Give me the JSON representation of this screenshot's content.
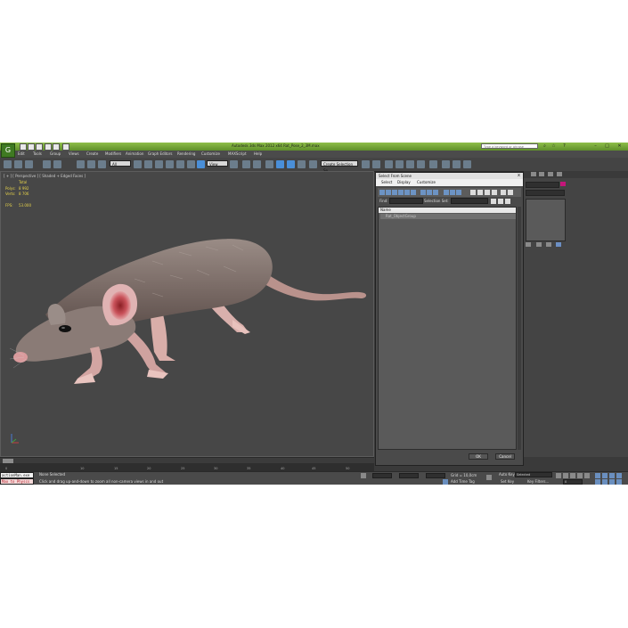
{
  "app": {
    "logo": "G",
    "title": "Autodesk 3ds Max  2012 x64     Rat_Pose_2_3M.max",
    "search_placeholder": "Type a keyword or phrase",
    "window_controls": [
      "–",
      "□",
      "✕"
    ]
  },
  "menubar": [
    "Edit",
    "Tools",
    "Group",
    "Views",
    "Create",
    "Modifiers",
    "Animation",
    "Graph Editors",
    "Rendering",
    "Customize",
    "MAXScript",
    "Help"
  ],
  "toolbar": {
    "filter_dropdown": "All",
    "refcoord_dropdown": "View",
    "named_selection": "Create Selection Se"
  },
  "viewport": {
    "label": "[ + ] [ Perspective ] [ Shaded + Edged Faces ]",
    "stats": {
      "total_label": "Total",
      "polys_label": "Polys:",
      "polys_value": "8 992",
      "verts_label": "Verts:",
      "verts_value": "8 706",
      "fps_label": "FPS:",
      "fps_value": "53.000"
    }
  },
  "dialog": {
    "title": "Select From Scene",
    "close": "x",
    "menu": [
      "Select",
      "Display",
      "Customize"
    ],
    "find_label": "Find:",
    "selection_set_label": "Selection Set:",
    "column_header": "Name",
    "rows": [
      "Rat_ObjectGroup"
    ],
    "ok_label": "OK",
    "cancel_label": "Cancel"
  },
  "timeline": {
    "ticks": [
      "0",
      "10",
      "15",
      "20",
      "25",
      "30",
      "35",
      "40",
      "45",
      "50"
    ],
    "slider_label": "0 / 100"
  },
  "status": {
    "script_line1": "actionMan.exe",
    "script_line2": "Max to Physcs",
    "selection": "None Selected",
    "prompt": "Click and drag up-and-down to zoom all non-camera views in and out",
    "grid": "Grid = 10,0cm",
    "add_time_tag": "Add Time Tag",
    "autokey": "Auto Key",
    "setkey": "Set Key",
    "selected_dropdown": "Selected",
    "key_filters": "Key Filters...",
    "frame": "0"
  },
  "colors": {
    "title_green": "#8fbf4a",
    "stats_yellow": "#e6d24a",
    "ui_dark": "#444444",
    "highlight_blue": "#4a8fd8"
  }
}
